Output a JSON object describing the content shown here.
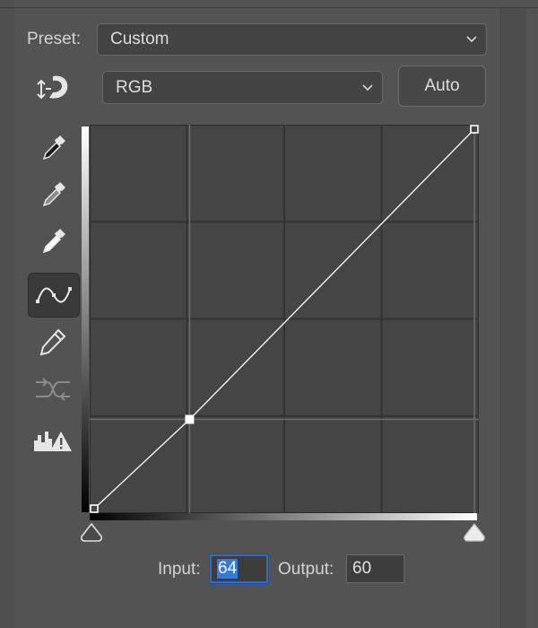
{
  "preset": {
    "label": "Preset:",
    "value": "Custom"
  },
  "channel": {
    "value": "RGB"
  },
  "auto_button": {
    "label": "Auto"
  },
  "tools": [
    {
      "name": "on-image-adjust-icon",
      "active": false
    },
    {
      "name": "black-point-eyedropper-icon",
      "active": false
    },
    {
      "name": "gray-point-eyedropper-icon",
      "active": false
    },
    {
      "name": "white-point-eyedropper-icon",
      "active": false
    },
    {
      "name": "curve-points-icon",
      "active": true
    },
    {
      "name": "pencil-icon",
      "active": false
    },
    {
      "name": "smooth-curve-icon",
      "active": false
    },
    {
      "name": "clipping-warning-icon",
      "active": false
    }
  ],
  "curve": {
    "input_range": [
      0,
      255
    ],
    "output_range": [
      0,
      255
    ],
    "points": [
      {
        "input": 0,
        "output": 0
      },
      {
        "input": 64,
        "output": 60,
        "selected": true
      },
      {
        "input": 255,
        "output": 255
      }
    ],
    "grid_divisions": 4
  },
  "io": {
    "input_label": "Input:",
    "input_value": "64",
    "output_label": "Output:",
    "output_value": "60"
  },
  "colors": {
    "panel_bg": "#535353",
    "graph_bg": "#454545",
    "focus": "#2e6cc9"
  }
}
